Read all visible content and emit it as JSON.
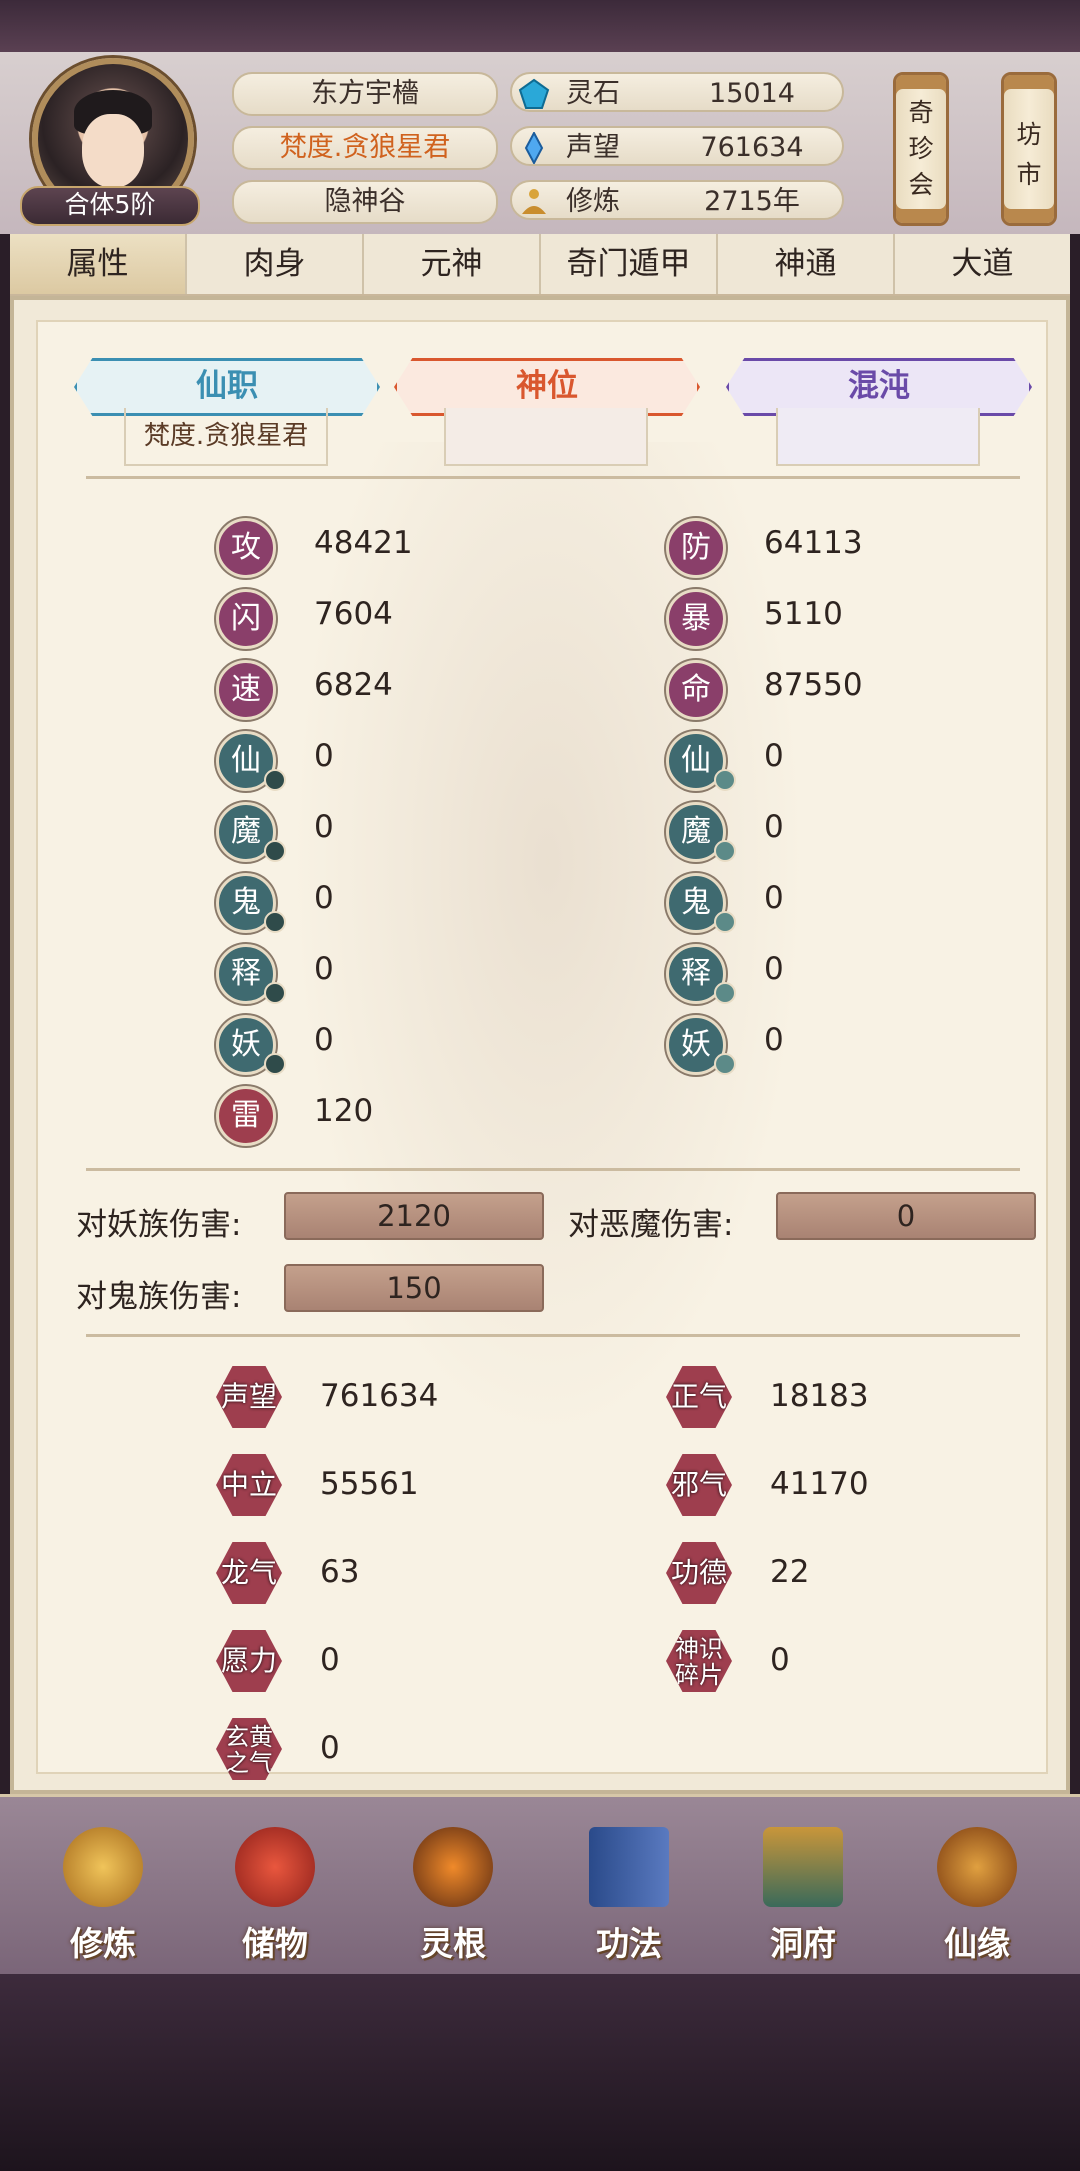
{
  "player": {
    "name": "东方宇檣",
    "title": "梵度.贪狼星君",
    "sect": "隐神谷",
    "realm": "合体5阶"
  },
  "resources": [
    {
      "label": "灵石",
      "value": "15014",
      "icon": "spirit-stone-icon"
    },
    {
      "label": "声望",
      "value": "761634",
      "icon": "prestige-crystal-icon"
    },
    {
      "label": "修炼",
      "value": "2715年",
      "icon": "cultivation-meditation-icon"
    }
  ],
  "side_buttons": {
    "treasure_fair": "奇珍会",
    "market": "坊市"
  },
  "tabs": [
    "属性",
    "肉身",
    "元神",
    "奇门遁甲",
    "神通",
    "大道"
  ],
  "positions": {
    "immortal_post": {
      "label": "仙职",
      "value": "梵度.贪狼星君",
      "color": "#3b8fb2"
    },
    "god_post": {
      "label": "神位",
      "value": "",
      "color": "#d9572e"
    },
    "chaos": {
      "label": "混沌",
      "value": "",
      "color": "#6a4aa8"
    }
  },
  "stats_left": [
    {
      "char": "攻",
      "value": "48421"
    },
    {
      "char": "闪",
      "value": "7604"
    },
    {
      "char": "速",
      "value": "6824"
    },
    {
      "char": "仙",
      "value": "0"
    },
    {
      "char": "魔",
      "value": "0"
    },
    {
      "char": "鬼",
      "value": "0"
    },
    {
      "char": "释",
      "value": "0"
    },
    {
      "char": "妖",
      "value": "0"
    },
    {
      "char": "雷",
      "value": "120"
    }
  ],
  "stats_right": [
    {
      "char": "防",
      "value": "64113"
    },
    {
      "char": "暴",
      "value": "5110"
    },
    {
      "char": "命",
      "value": "87550"
    },
    {
      "char": "仙",
      "value": "0"
    },
    {
      "char": "魔",
      "value": "0"
    },
    {
      "char": "鬼",
      "value": "0"
    },
    {
      "char": "释",
      "value": "0"
    },
    {
      "char": "妖",
      "value": "0"
    }
  ],
  "damage": {
    "vs_yao_label": "对妖族伤害:",
    "vs_yao_value": "2120",
    "vs_demon_label": "对恶魔伤害:",
    "vs_demon_value": "0",
    "vs_ghost_label": "对鬼族伤害:",
    "vs_ghost_value": "150"
  },
  "reputation_left": [
    {
      "label": "声望",
      "value": "761634"
    },
    {
      "label": "中立",
      "value": "55561"
    },
    {
      "label": "龙气",
      "value": "63"
    },
    {
      "label": "愿力",
      "value": "0"
    },
    {
      "label": "玄黄之气",
      "value": "0"
    }
  ],
  "reputation_right": [
    {
      "label": "正气",
      "value": "18183"
    },
    {
      "label": "邪气",
      "value": "41170"
    },
    {
      "label": "功德",
      "value": "22"
    },
    {
      "label": "神识碎片",
      "value": "0"
    }
  ],
  "nav": [
    {
      "label": "修炼",
      "icon": "cultivator-icon"
    },
    {
      "label": "储物",
      "icon": "storage-bag-icon"
    },
    {
      "label": "灵根",
      "icon": "spirit-root-icon"
    },
    {
      "label": "功法",
      "icon": "technique-book-icon"
    },
    {
      "label": "洞府",
      "icon": "cave-dwelling-icon"
    },
    {
      "label": "仙缘",
      "icon": "gourd-icon"
    }
  ]
}
